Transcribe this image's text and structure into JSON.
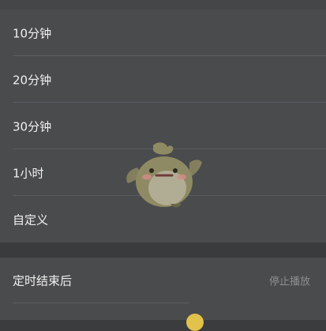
{
  "timer_options": [
    {
      "label": "10分钟"
    },
    {
      "label": "20分钟"
    },
    {
      "label": "30分钟"
    },
    {
      "label": "1小时"
    },
    {
      "label": "自定义"
    }
  ],
  "after_timer": {
    "label": "定时结束后",
    "value": "停止播放"
  },
  "colors": {
    "background": "#3b3c3e",
    "row": "#4a4b4d",
    "text": "#f0f0f0",
    "secondary_text": "#8f9092",
    "accent": "#e2c24a"
  }
}
